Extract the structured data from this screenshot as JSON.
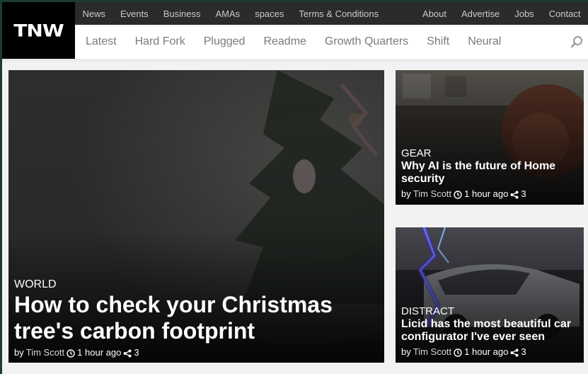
{
  "brand": {
    "logo": "TNW"
  },
  "top_nav": {
    "left": [
      "News",
      "Events",
      "Business",
      "AMAs",
      "spaces",
      "Terms & Conditions"
    ],
    "right": [
      "About",
      "Advertise",
      "Jobs",
      "Contact"
    ]
  },
  "section_nav": [
    "Latest",
    "Hard Fork",
    "Plugged",
    "Readme",
    "Growth Quarters",
    "Shift",
    "Neural"
  ],
  "search_icon": "search-icon",
  "featured": {
    "category": "WORLD",
    "title": "How to check your Christmas tree's carbon footprint",
    "by": "by",
    "author": "Tim Scott",
    "time": "1 hour ago",
    "shares": "3"
  },
  "side_stories": [
    {
      "category": "GEAR",
      "title": "Why AI is the future of Home security",
      "by": "by",
      "author": "Tim Scott",
      "time": "1 hour ago",
      "shares": "3"
    },
    {
      "category": "DISTRACT",
      "title": "Licid has the most beautiful car configurator I've ever seen",
      "by": "by",
      "author": "Tim Scott",
      "time": "1 hour ago",
      "shares": "3"
    }
  ],
  "colors": {
    "frame_border": "#1d3a35",
    "top_bar": "#2b2b2b",
    "section_bar": "#ffffff",
    "logo_bg": "#000000"
  }
}
